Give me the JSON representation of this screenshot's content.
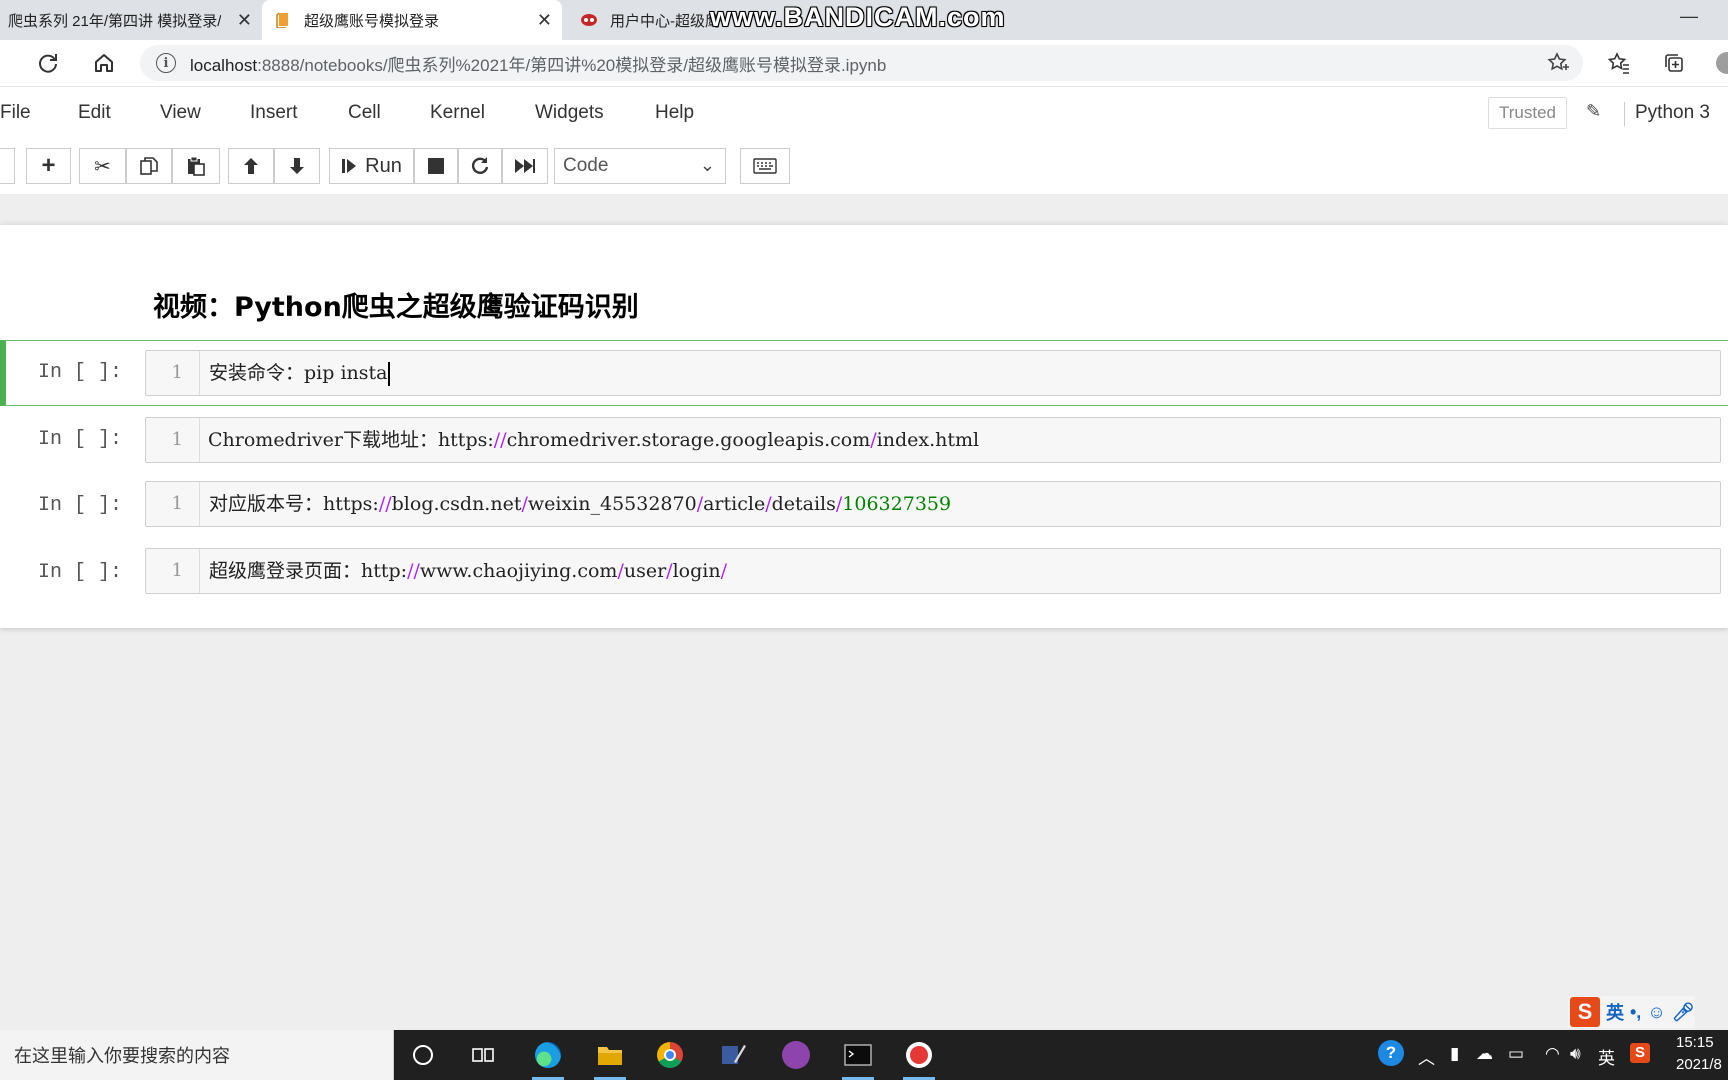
{
  "browser": {
    "tabs": [
      {
        "title": "爬虫系列 21年/第四讲 模拟登录/"
      },
      {
        "title": "超级鹰账号模拟登录"
      },
      {
        "title": "用户中心-超级鹰"
      }
    ],
    "watermark": "www.BANDICAM.com",
    "url_host": "localhost",
    "url_rest": ":8888/notebooks/爬虫系列%2021年/第四讲%20模拟登录/超级鹰账号模拟登录.ipynb"
  },
  "menubar": {
    "items": [
      "File",
      "Edit",
      "View",
      "Insert",
      "Cell",
      "Kernel",
      "Widgets",
      "Help"
    ],
    "trusted": "Trusted",
    "kernel": "Python 3"
  },
  "toolbar": {
    "run_label": "Run",
    "cell_type": "Code"
  },
  "notebook": {
    "heading": "视频：Python爬虫之超级鹰验证码识别",
    "cells": [
      {
        "prompt": "In  [ ]:",
        "line_no": "1",
        "text": "安装命令：pip insta"
      },
      {
        "prompt": "In  [ ]:",
        "line_no": "1",
        "text_a": "Chromedriver下载地址：https:",
        "text_b": "//",
        "text_c": "chromedriver.storage.googleapis.com",
        "text_d": "/",
        "text_e": "index.html"
      },
      {
        "prompt": "In  [ ]:",
        "line_no": "1",
        "text_a": "对应版本号：https:",
        "text_b": "//",
        "text_c": "blog.csdn.net",
        "text_d": "/",
        "text_e": "weixin_45532870",
        "text_f": "/",
        "text_g": "article",
        "text_h": "/",
        "text_i": "details",
        "text_j": "/",
        "text_k": "106327359"
      },
      {
        "prompt": "In  [ ]:",
        "line_no": "1",
        "text_a": "超级鹰登录页面：http:",
        "text_b": "//",
        "text_c": "www.chaojiying.com",
        "text_d": "/",
        "text_e": "user",
        "text_f": "/",
        "text_g": "login",
        "text_h": "/"
      }
    ]
  },
  "taskbar": {
    "search_placeholder": "在这里输入你要搜索的内容",
    "ime_lang": "英",
    "tray_lang": "英",
    "time": "15:15",
    "date": "2021/8"
  },
  "colors": {
    "selected_cell": "#4caf50",
    "code_operator": "#aa22ff",
    "code_number": "#008000"
  }
}
